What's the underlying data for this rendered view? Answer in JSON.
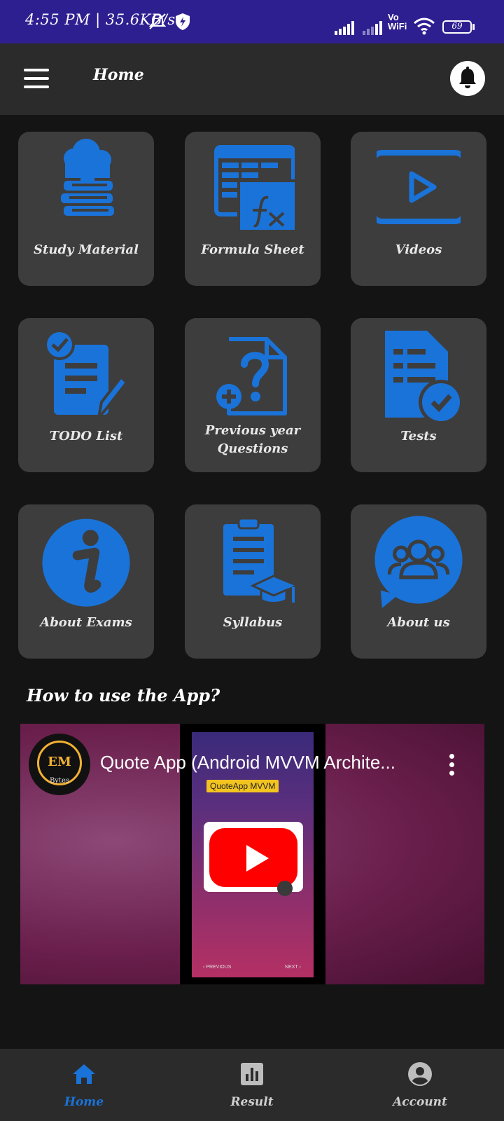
{
  "status_bar": {
    "time": "4:55 PM | 35.6KB/s",
    "battery": "69",
    "vowifi": "Vo WiFi",
    "icons": [
      "mute-icon",
      "shield-icon",
      "signal-icon",
      "signal-icon",
      "wifi-icon",
      "battery-icon"
    ]
  },
  "app_bar": {
    "title": "Home",
    "menu_icon": "hamburger-icon",
    "notification_icon": "bell-icon"
  },
  "tiles": [
    {
      "label": "Study Material",
      "icon": "books-cloud-icon"
    },
    {
      "label": "Formula Sheet",
      "icon": "formula-sheet-icon"
    },
    {
      "label": "Videos",
      "icon": "video-play-icon"
    },
    {
      "label": "TODO List",
      "icon": "todo-list-icon"
    },
    {
      "label": "Previous year Questions",
      "icon": "question-file-icon"
    },
    {
      "label": "Tests",
      "icon": "test-check-icon"
    },
    {
      "label": "About Exams",
      "icon": "info-icon"
    },
    {
      "label": "Syllabus",
      "icon": "syllabus-icon"
    },
    {
      "label": "About us",
      "icon": "group-chat-icon"
    }
  ],
  "section": {
    "title": "How to use the App?"
  },
  "video": {
    "title": "Quote App (Android MVVM Archite...",
    "channel_logo_text": "EM",
    "channel_logo_subtext": "Bytes",
    "chip": "QuoteApp MVVM",
    "prev": "‹ PREVIOUS",
    "next": "NEXT ›"
  },
  "bottom_nav": [
    {
      "label": "Home",
      "icon": "home-icon",
      "active": true
    },
    {
      "label": "Result",
      "icon": "bar-chart-icon",
      "active": false
    },
    {
      "label": "Account",
      "icon": "account-icon",
      "active": false
    }
  ],
  "colors": {
    "status_bar": "#2e1f91",
    "accent": "#1a73d9",
    "tile": "#3d3d3d",
    "background": "#141414"
  }
}
